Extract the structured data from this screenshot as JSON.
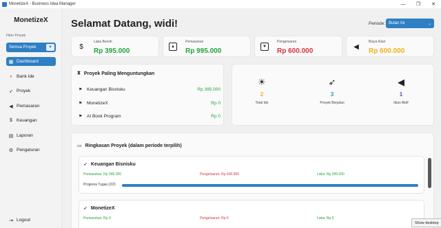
{
  "window": {
    "title": "MonetizeX - Business Idea Manager",
    "controls": {
      "minimize": "—",
      "maximize": "❐",
      "close": "✕"
    }
  },
  "sidebar": {
    "brand": "MonetizeX",
    "filter_label": "Filter Proyek",
    "project_select": "Semua Proyek",
    "items": [
      {
        "label": "Dashboard",
        "icon": "dashboard-icon",
        "active": true
      },
      {
        "label": "Bank Ide",
        "icon": "lightbulb-icon"
      },
      {
        "label": "Proyek",
        "icon": "rocket-icon"
      },
      {
        "label": "Pemasaran",
        "icon": "megaphone-icon"
      },
      {
        "label": "Keuangan",
        "icon": "money-bag-icon"
      },
      {
        "label": "Laporan",
        "icon": "document-icon"
      },
      {
        "label": "Pengaturan",
        "icon": "gear-icon"
      }
    ],
    "logout": "Logout"
  },
  "header": {
    "welcome": "Selamat Datang, widi!",
    "period_label": "Periode:",
    "period_value": "Bulan Ini"
  },
  "kpis": [
    {
      "label": "Laba Bersih",
      "value": "Rp 395.000",
      "color": "#22a33a",
      "icon": "money-bag-icon"
    },
    {
      "label": "Pemasukan",
      "value": "Rp 995.000",
      "color": "#22a33a",
      "icon": "arrow-up-box-icon"
    },
    {
      "label": "Pengeluaran",
      "value": "Rp 600.000",
      "color": "#d9323a",
      "icon": "arrow-down-box-icon"
    },
    {
      "label": "Biaya Iklan",
      "value": "Rp 600.000",
      "color": "#f2b21b",
      "icon": "megaphone-icon"
    }
  ],
  "top_projects": {
    "title": "Proyek Paling Menguntungkan",
    "rows": [
      {
        "name": "Keuangan Bisnisku",
        "value": "Rp 395.000"
      },
      {
        "name": "MonetizeX",
        "value": "Rp 0"
      },
      {
        "name": "AI Book Program",
        "value": "Rp 0"
      }
    ]
  },
  "stats": [
    {
      "number": "2",
      "label": "Total Ide",
      "color": "#f2b21b",
      "icon": "lightbulb-icon"
    },
    {
      "number": "3",
      "label": "Proyek Berjalan",
      "color": "#2ba0b5",
      "icon": "rocket-icon"
    },
    {
      "number": "1",
      "label": "Iklan Aktif",
      "color": "#6a4fb0",
      "icon": "megaphone-icon"
    }
  ],
  "summary": {
    "title": "Ringkasan Proyek (dalam periode terpilih)",
    "projects": [
      {
        "name": "Keuangan Bisnisku",
        "income": "Pemasukan: Rp 995.000",
        "expense": "Pengeluaran: Rp 600.000",
        "profit": "Laba: Rp 395.000",
        "progress_label": "Progress Tugas (2/2)",
        "progress": 1.0
      },
      {
        "name": "MonetizeX",
        "income": "Pemasukan: Rp 0",
        "expense": "Pengeluaran: Rp 0",
        "profit": "Laba: Rp 0"
      }
    ]
  },
  "colors": {
    "accent": "#2e7fc4",
    "positive": "#22a33a",
    "negative": "#d9323a",
    "warning": "#f2b21b"
  },
  "tooltip": "Show desktop"
}
